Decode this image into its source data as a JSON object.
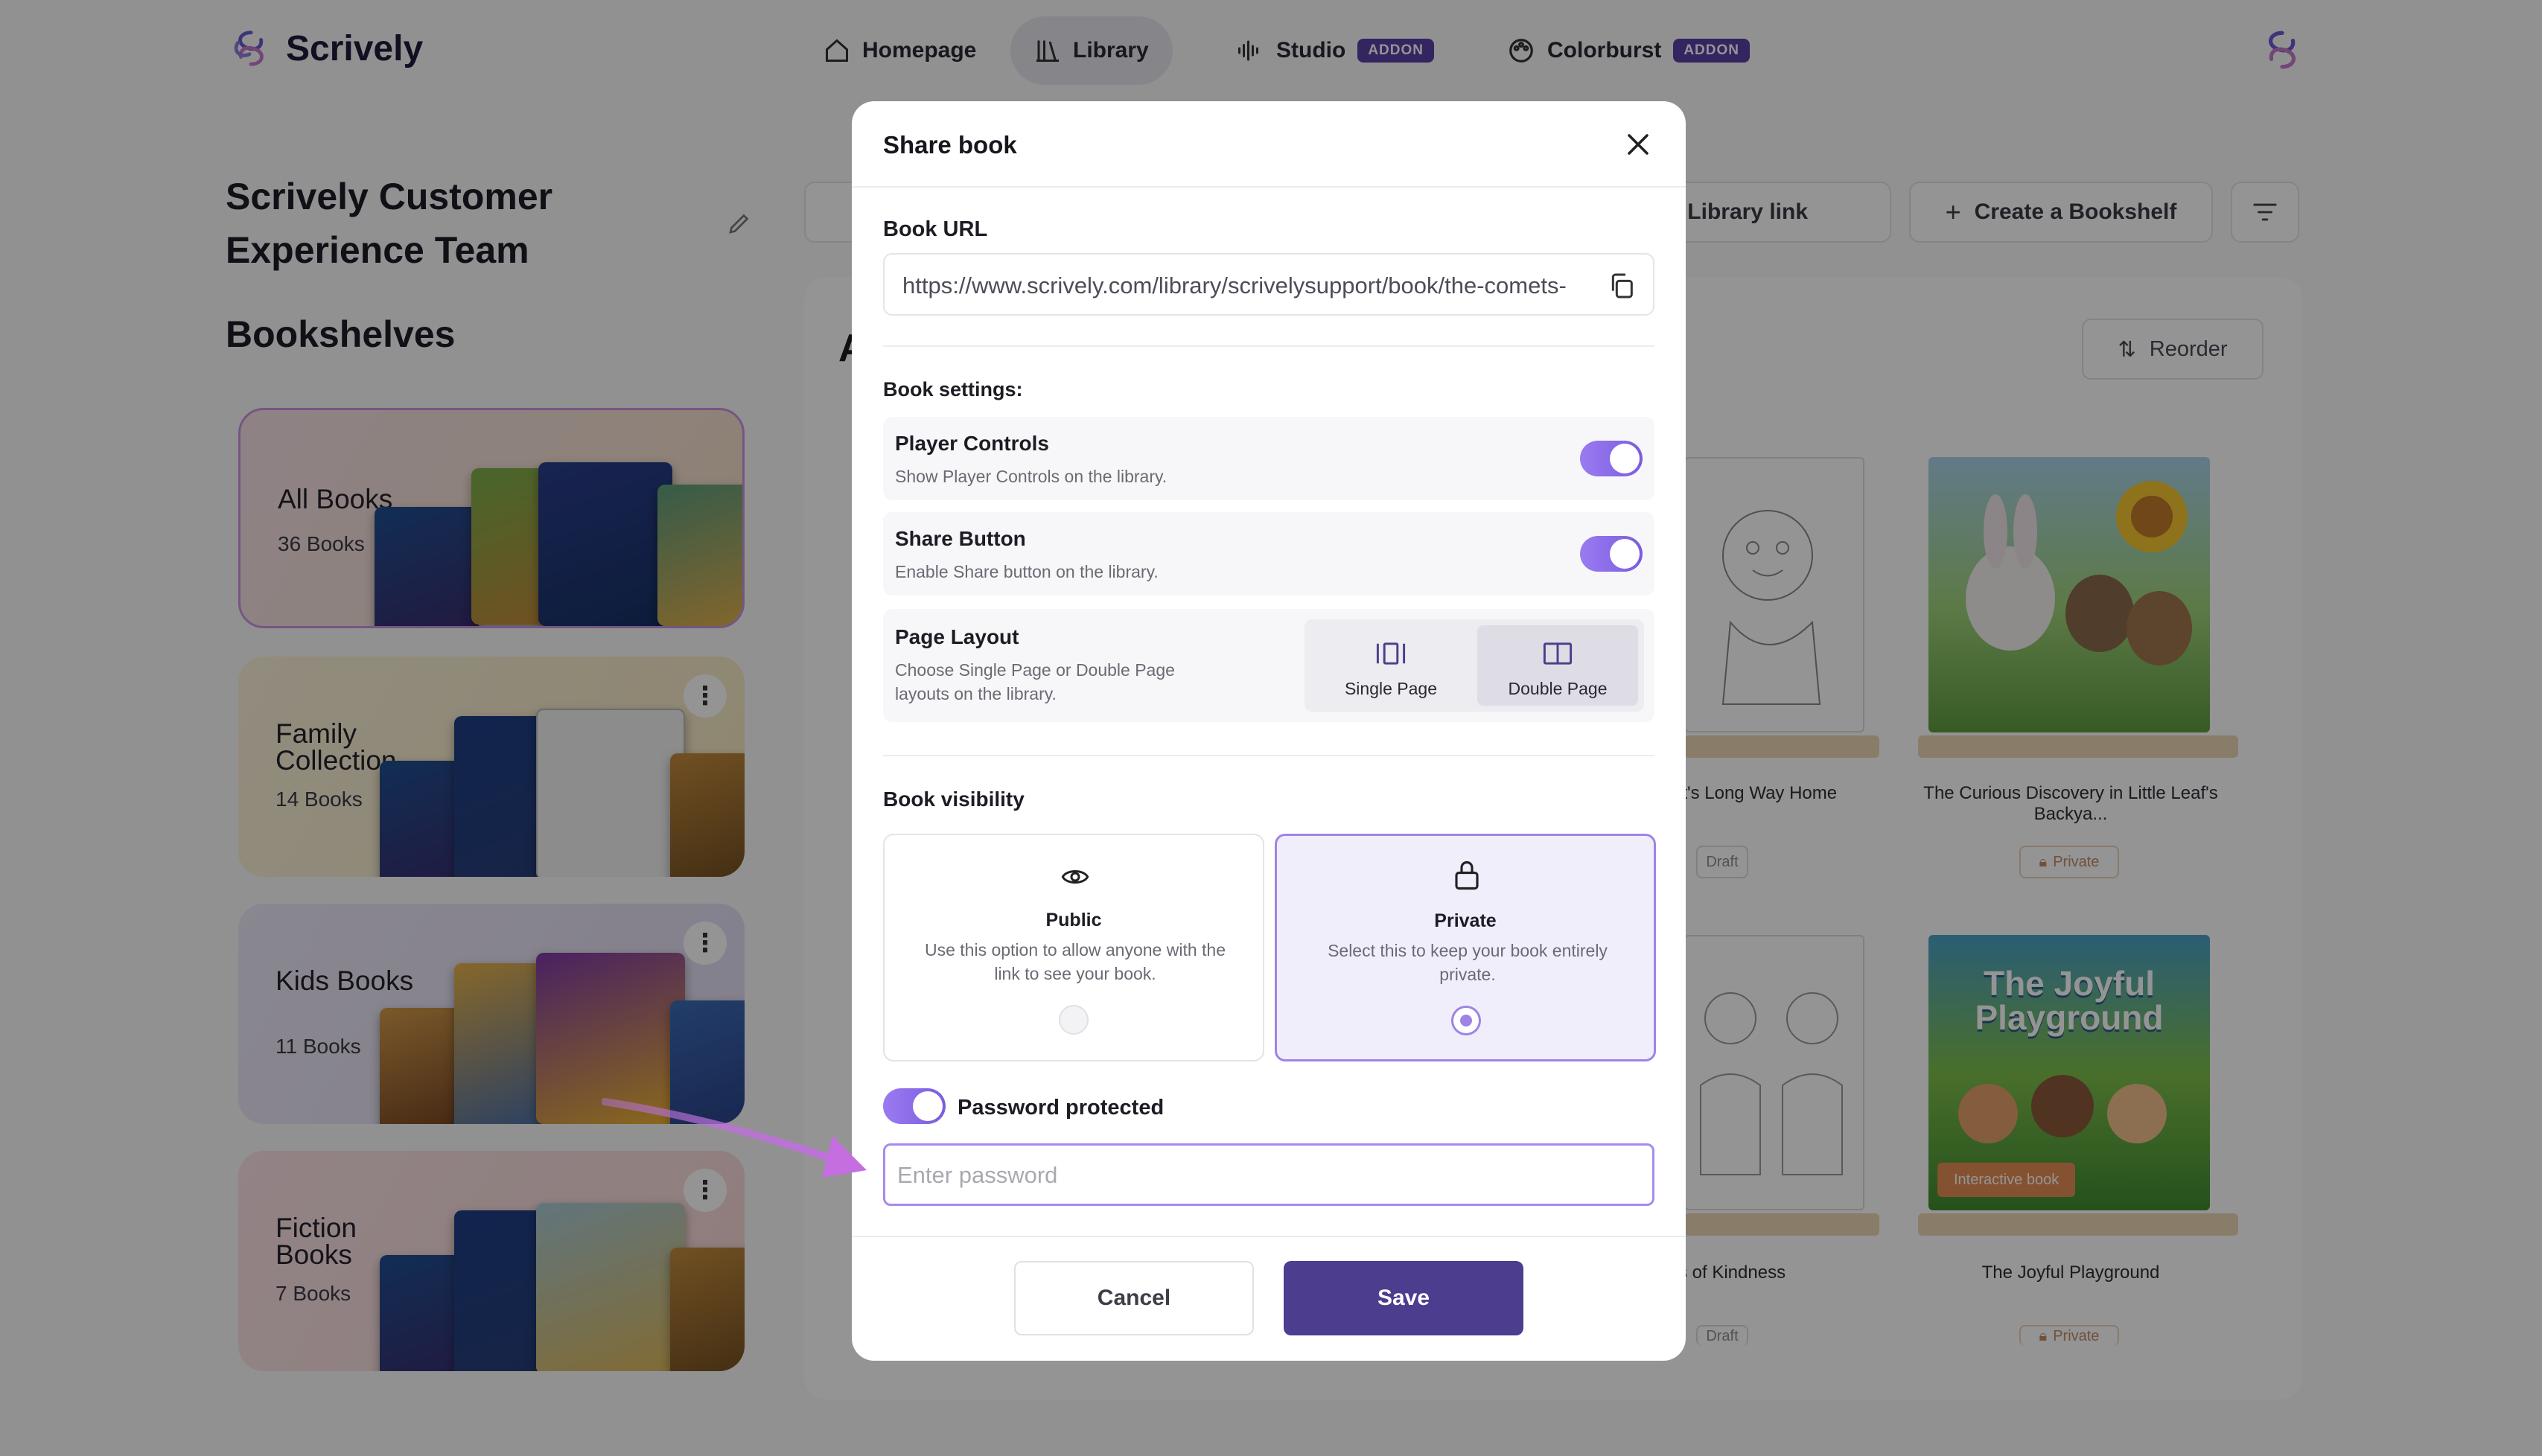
{
  "app": {
    "name": "Scrively",
    "brand_color": "#5a3fa6"
  },
  "nav": {
    "homepage": "Homepage",
    "library": "Library",
    "studio": "Studio",
    "studio_badge": "ADDON",
    "colorburst": "Colorburst",
    "colorburst_badge": "ADDON"
  },
  "sidebar": {
    "team_name": "Scrively Customer Experience Team",
    "bookshelves_heading": "Bookshelves",
    "shelves": [
      {
        "name": "All Books",
        "count": "36 Books"
      },
      {
        "name": "Family Collection",
        "count": "14 Books"
      },
      {
        "name": "Kids Books",
        "count": "11 Books"
      },
      {
        "name": "Fiction Books",
        "count": "7 Books"
      }
    ]
  },
  "toolbar": {
    "library_link": "Library link",
    "create_bookshelf": "Create a Bookshelf"
  },
  "main": {
    "reorder": "Reorder",
    "heading_partial": "A",
    "books": [
      {
        "title": "et's Long Way Home",
        "status": "Draft"
      },
      {
        "title": "The Curious Discovery in Little Leaf's Backya...",
        "status": "Private"
      },
      {
        "title": "rs of Kindness",
        "status": "Draft"
      },
      {
        "title": "The Joyful Playground",
        "status": "Private"
      }
    ],
    "interactive_label": "Interactive book"
  },
  "modal": {
    "title": "Share book",
    "url_label": "Book URL",
    "url_value": "https://www.scrively.com/library/scrivelysupport/book/the-comets-",
    "settings_label": "Book settings:",
    "player_controls": {
      "title": "Player Controls",
      "desc": "Show Player Controls on the library.",
      "enabled": true
    },
    "share_button": {
      "title": "Share Button",
      "desc": "Enable Share button on the library.",
      "enabled": true
    },
    "page_layout": {
      "title": "Page Layout",
      "desc": "Choose Single Page or Double Page layouts on the library.",
      "single": "Single Page",
      "double": "Double Page",
      "selected": "Double Page"
    },
    "visibility_label": "Book visibility",
    "public": {
      "title": "Public",
      "desc": "Use this option to allow anyone with the link to see your book."
    },
    "private": {
      "title": "Private",
      "desc": "Select this to keep your book entirely private."
    },
    "visibility_selected": "Private",
    "password_toggle_label": "Password protected",
    "password_enabled": true,
    "password_placeholder": "Enter password",
    "password_value": "",
    "cancel": "Cancel",
    "save": "Save"
  }
}
